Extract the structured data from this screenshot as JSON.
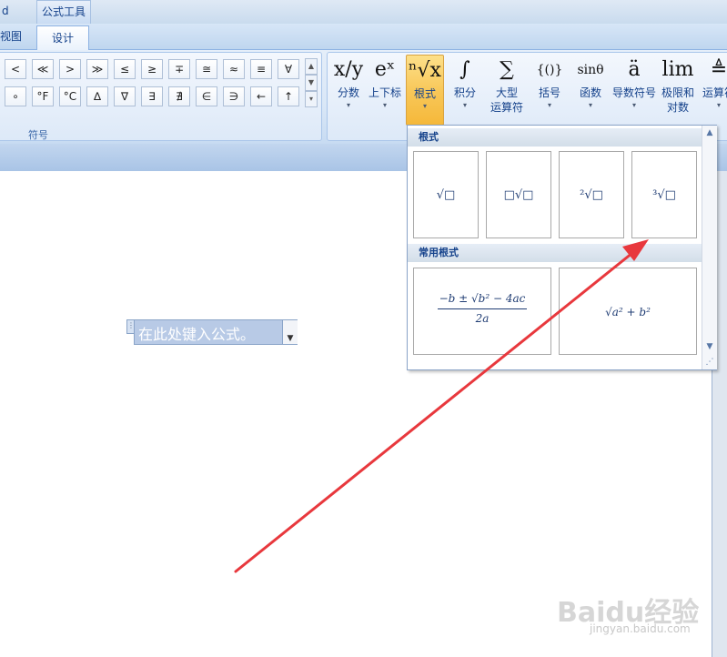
{
  "titlebar": {
    "left_fragment": "d",
    "contextual_tab": "公式工具"
  },
  "tabs": {
    "view": "视图",
    "design": "设计"
  },
  "symbols": {
    "row1": [
      "<",
      "≪",
      ">",
      "≫",
      "≤",
      "≥",
      "∓",
      "≅",
      "≈",
      "≡",
      "∀"
    ],
    "row2": [
      "∘",
      "°F",
      "°C",
      "∆",
      "∇",
      "∃",
      "∄",
      "∈",
      "∋",
      "←",
      "↑"
    ],
    "group_label": "符号"
  },
  "structures": [
    {
      "glyph": "x/y",
      "label": "分数"
    },
    {
      "glyph": "eˣ",
      "label": "上下标"
    },
    {
      "glyph": "ⁿ√x",
      "label": "根式"
    },
    {
      "glyph": "∫",
      "label": "积分"
    },
    {
      "glyph": "∑",
      "label": "大型",
      "label2": "运算符"
    },
    {
      "glyph": "{()}",
      "label": "括号"
    },
    {
      "glyph": "sinθ",
      "label": "函数"
    },
    {
      "glyph": "ä",
      "label": "导数符号"
    },
    {
      "glyph": "lim",
      "label": "极限和",
      "label2": "对数"
    },
    {
      "glyph": "≜",
      "label": "运算符"
    }
  ],
  "document": {
    "placeholder": "在此处键入公式。"
  },
  "dropdown": {
    "header_radicals": "根式",
    "header_common": "常用根式",
    "radicals": [
      "√□",
      "□√□",
      "²√□",
      "³√□"
    ],
    "common": [
      "(−b ± √(b² − 4ac)) / 2a",
      "√(a² + b²)"
    ],
    "quad_numerator": "−b ± √b² − 4ac",
    "quad_denominator": "2a",
    "pythag": "√a² + b²"
  },
  "watermark": {
    "brand": "Baidu经验",
    "url": "jingyan.baidu.com"
  },
  "colors": {
    "arrow": "#e8383d",
    "active": "#f8c85a"
  }
}
